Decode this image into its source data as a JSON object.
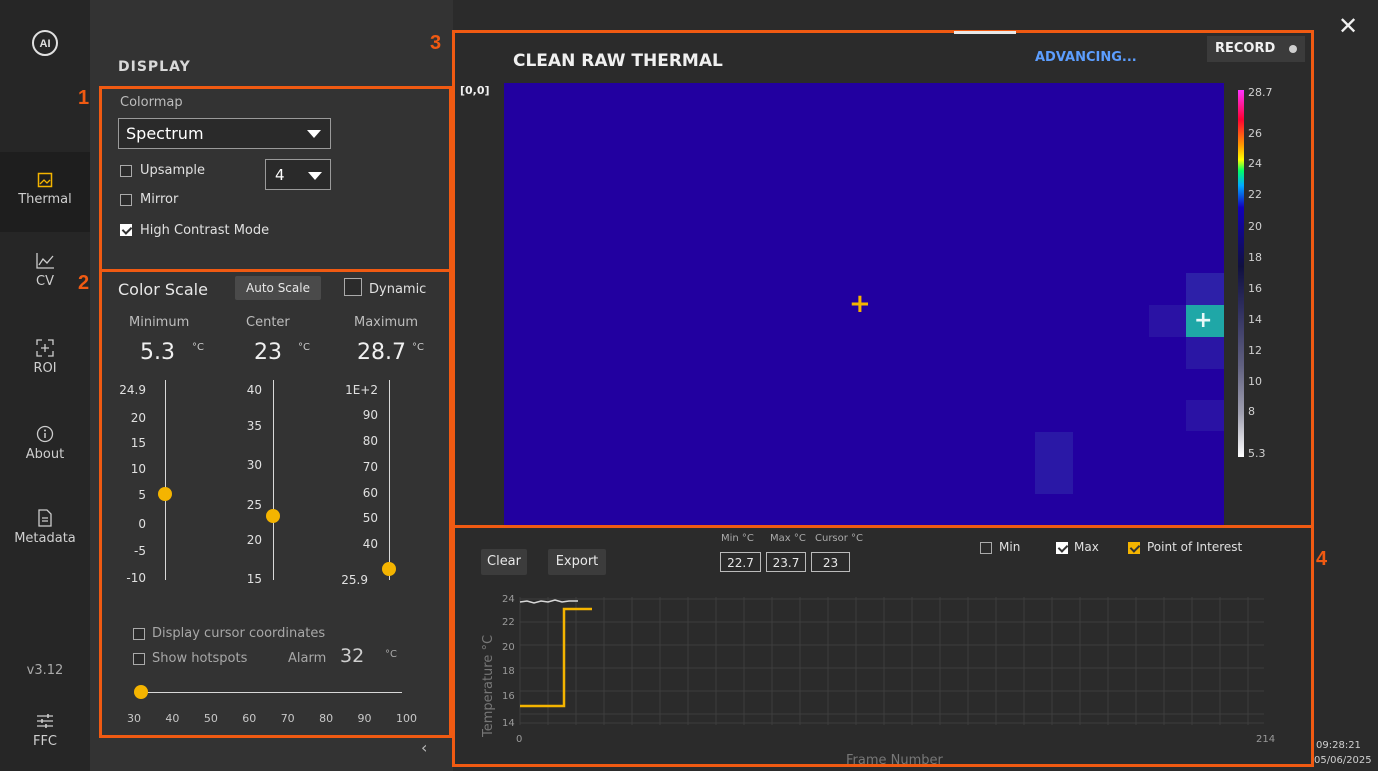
{
  "sidebar": {
    "items": [
      {
        "label": "Thermal",
        "icon": "image-icon"
      },
      {
        "label": "CV",
        "icon": "chart-line-icon"
      },
      {
        "label": "ROI",
        "icon": "roi-icon"
      },
      {
        "label": "About",
        "icon": "info-icon"
      },
      {
        "label": "Metadata",
        "icon": "document-icon"
      }
    ],
    "version": "v3.12",
    "ffc_label": "FFC"
  },
  "callouts": {
    "one": "1",
    "two": "2",
    "three": "3",
    "four": "4"
  },
  "display": {
    "title": "DISPLAY",
    "colormap_label": "Colormap",
    "colormap_value": "Spectrum",
    "upsample_label": "Upsample",
    "upsample_value": "4",
    "mirror_label": "Mirror",
    "high_contrast_label": "High Contrast Mode",
    "upsample_checked": false,
    "mirror_checked": false,
    "high_contrast_checked": true
  },
  "color_scale": {
    "title": "Color Scale",
    "auto_scale_label": "Auto Scale",
    "dynamic_label": "Dynamic",
    "minimum_label": "Minimum",
    "center_label": "Center",
    "maximum_label": "Maximum",
    "min_value": "5.3",
    "center_value": "23",
    "max_value": "28.7",
    "unit": "°C",
    "min_ticks": [
      "24.9",
      "20",
      "15",
      "10",
      "5",
      "0",
      "-5",
      "-10"
    ],
    "center_ticks": [
      "40",
      "35",
      "30",
      "25",
      "20",
      "15"
    ],
    "max_ticks": [
      "1E+2",
      "90",
      "80",
      "70",
      "60",
      "50",
      "40",
      "25.9"
    ],
    "display_cursor_label": "Display cursor coordinates",
    "show_hotspots_label": "Show hotspots",
    "alarm_label": "Alarm",
    "alarm_value": "32",
    "alarm_unit": "°C",
    "alarm_ticks": [
      "30",
      "40",
      "50",
      "60",
      "70",
      "80",
      "90",
      "100"
    ]
  },
  "thermal": {
    "title": "CLEAN RAW THERMAL",
    "status": "ADVANCING...",
    "record_label": "RECORD",
    "origin": "[0,0]",
    "colorbar_ticks": [
      "28.7",
      "26",
      "24",
      "22",
      "20",
      "18",
      "16",
      "14",
      "12",
      "10",
      "8",
      "5.3"
    ]
  },
  "graph": {
    "clear_label": "Clear",
    "export_label": "Export",
    "min_header": "Min °C",
    "max_header": "Max °C",
    "cursor_header": "Cursor °C",
    "min_value": "22.7",
    "max_value": "23.7",
    "cursor_value": "23",
    "legend_min": "Min",
    "legend_max": "Max",
    "legend_poi": "Point of Interest",
    "ylabel": "Temperature °C",
    "xlabel": "Frame Number",
    "y_ticks": [
      "24",
      "22",
      "20",
      "18",
      "16",
      "14"
    ],
    "x_start": "0",
    "x_end": "214"
  },
  "clock": {
    "time": "09:28:21",
    "date": "05/06/2025"
  },
  "colors": {
    "accent": "#f05a12",
    "gold": "#f4b400",
    "heat": "#2200a0"
  }
}
